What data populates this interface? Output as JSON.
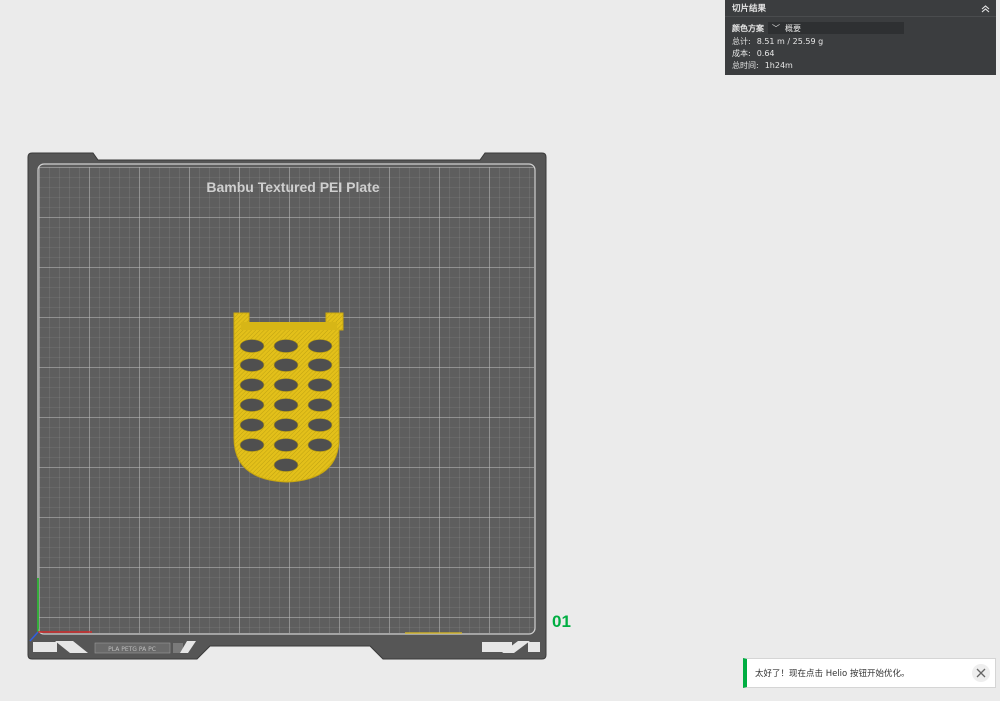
{
  "slice_result": {
    "title": "切片结果",
    "color_scheme_label": "颜色方案",
    "color_scheme_value": "概要",
    "total_label": "总计:",
    "total_value": "8.51 m / 25.59 g",
    "cost_label": "成本:",
    "cost_value": "0.64",
    "time_label": "总时间:",
    "time_value": "1h24m"
  },
  "plate": {
    "name": "Bambu Textured PEI Plate",
    "number": "01",
    "number_color": "#00ae42",
    "model_color": "#e3c01a",
    "sticker_text": "PLA PETG PA PC",
    "plate_color": "#5a5a5a"
  },
  "toast": {
    "message": "太好了！现在点击 Helio 按钮开始优化。",
    "accent_color": "#00ae42"
  }
}
